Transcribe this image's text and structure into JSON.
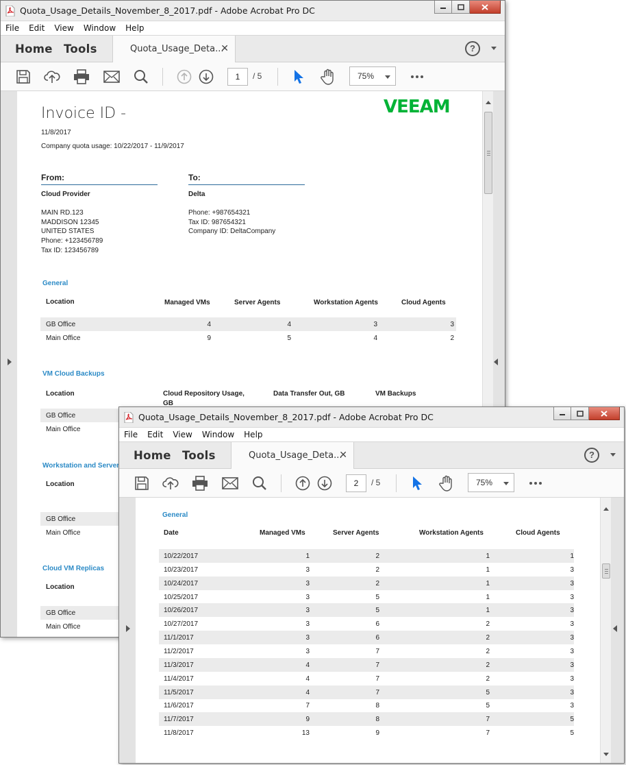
{
  "window_title": "Quota_Usage_Details_November_8_2017.pdf - Adobe Acrobat Pro DC",
  "menu": [
    "File",
    "Edit",
    "View",
    "Window",
    "Help"
  ],
  "nav": {
    "home": "Home",
    "tools": "Tools"
  },
  "doc_tab": "Quota_Usage_Deta...",
  "help_icon": "?",
  "zoom": "75%",
  "window1": {
    "page_current": "1",
    "page_total": "/ 5",
    "invoice_title": "Invoice ID -",
    "logo_text": "VEEAM",
    "date": "11/8/2017",
    "quota_usage": "Company quota usage: 10/22/2017 - 11/9/2017",
    "from": {
      "heading": "From:",
      "name": "Cloud Provider",
      "lines": [
        "MAIN RD.123",
        "MADDISON 12345",
        "UNITED STATES",
        "Phone: +123456789",
        "Tax ID: 123456789"
      ]
    },
    "to": {
      "heading": "To:",
      "name": "Delta",
      "lines": [
        "Phone: +987654321",
        "Tax ID: 987654321",
        "Company ID: DeltaCompany"
      ]
    },
    "general": {
      "title": "General",
      "headers": [
        "Location",
        "Managed VMs",
        "Server Agents",
        "Workstation Agents",
        "Cloud Agents"
      ],
      "rows": [
        [
          "GB Office",
          "4",
          "4",
          "3",
          "3"
        ],
        [
          "Main Office",
          "9",
          "5",
          "4",
          "2"
        ]
      ]
    },
    "vm_cloud_backups": {
      "title": "VM Cloud Backups",
      "headers": [
        "Location",
        "Cloud Repository Usage,",
        "GB",
        "Data Transfer Out, GB",
        "VM Backups"
      ],
      "rows": [
        "GB Office",
        "Main Office"
      ]
    },
    "workstation_server": {
      "title": "Workstation and Server",
      "header": "Location",
      "rows": [
        "GB Office",
        "Main Office"
      ]
    },
    "cloud_vm_replicas": {
      "title": "Cloud VM Replicas",
      "header": "Location",
      "rows": [
        "GB Office",
        "Main Office"
      ]
    }
  },
  "window2": {
    "page_current": "2",
    "page_total": "/ 5",
    "general": {
      "title": "General",
      "headers": [
        "Date",
        "Managed VMs",
        "Server Agents",
        "Workstation Agents",
        "Cloud Agents"
      ],
      "rows": [
        [
          "10/22/2017",
          "1",
          "2",
          "1",
          "1"
        ],
        [
          "10/23/2017",
          "3",
          "2",
          "1",
          "3"
        ],
        [
          "10/24/2017",
          "3",
          "2",
          "1",
          "3"
        ],
        [
          "10/25/2017",
          "3",
          "5",
          "1",
          "3"
        ],
        [
          "10/26/2017",
          "3",
          "5",
          "1",
          "3"
        ],
        [
          "10/27/2017",
          "3",
          "6",
          "2",
          "3"
        ],
        [
          "11/1/2017",
          "3",
          "6",
          "2",
          "3"
        ],
        [
          "11/2/2017",
          "3",
          "7",
          "2",
          "3"
        ],
        [
          "11/3/2017",
          "4",
          "7",
          "2",
          "3"
        ],
        [
          "11/4/2017",
          "4",
          "7",
          "2",
          "3"
        ],
        [
          "11/5/2017",
          "4",
          "7",
          "5",
          "3"
        ],
        [
          "11/6/2017",
          "7",
          "8",
          "5",
          "3"
        ],
        [
          "11/7/2017",
          "9",
          "8",
          "7",
          "5"
        ],
        [
          "11/8/2017",
          "13",
          "9",
          "7",
          "5"
        ]
      ]
    }
  },
  "colors": {
    "accent_blue": "#2b8ac6",
    "veeam_green": "#00b336",
    "cursor_blue": "#1473e6",
    "close_red": "#c3402c"
  }
}
